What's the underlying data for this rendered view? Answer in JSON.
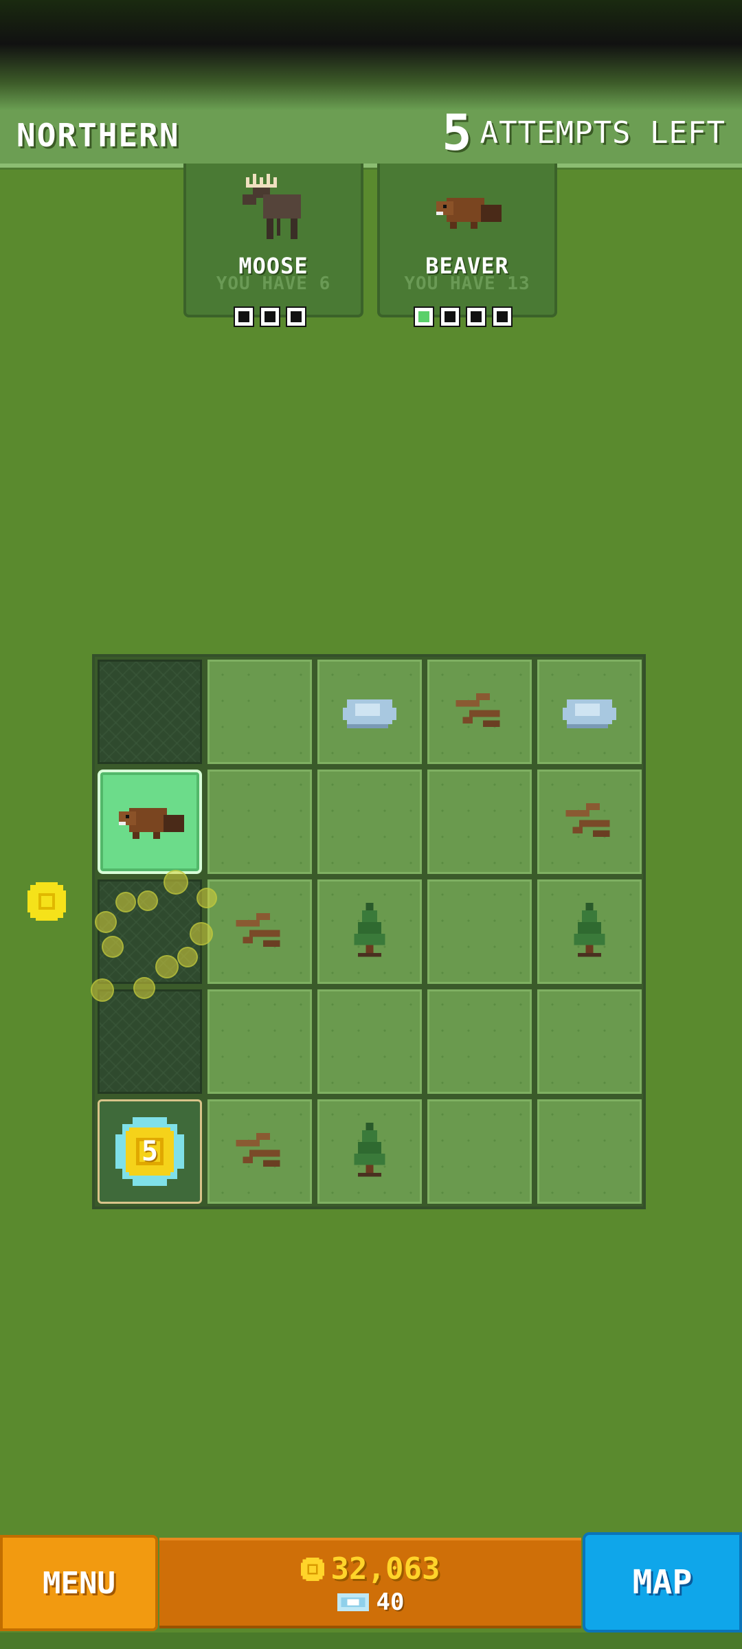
{
  "header": {
    "region": "NORTHERN",
    "attempts_count": "5",
    "attempts_label": "ATTEMPTS LEFT"
  },
  "goals": [
    {
      "name": "MOOSE",
      "have": "YOU HAVE 6",
      "progress_total": 3,
      "progress_done": 0,
      "icon": "moose-icon"
    },
    {
      "name": "BEAVER",
      "have": "YOU HAVE 13",
      "progress_total": 4,
      "progress_done": 1,
      "icon": "beaver-icon"
    }
  ],
  "board": {
    "rows": 5,
    "cols": 5,
    "cells": [
      [
        "empty-dark",
        "grass",
        "rock",
        "sticks",
        "rock"
      ],
      [
        "beaver-selected",
        "grass",
        "grass",
        "grass",
        "sticks"
      ],
      [
        "empty-dark",
        "sticks",
        "tree",
        "grass",
        "tree"
      ],
      [
        "empty-dark",
        "grass",
        "grass",
        "grass",
        "grass"
      ],
      [
        "coin-5",
        "sticks",
        "tree",
        "grass",
        "grass"
      ]
    ],
    "coin_tile_value": "5"
  },
  "footer": {
    "menu_label": "MENU",
    "coins": "32,063",
    "gems": "40",
    "map_label": "MAP"
  },
  "colors": {
    "background": "#5a8a2e",
    "menu": "#f29a10",
    "map": "#0fa6ea",
    "coin_text": "#ffd42a"
  }
}
